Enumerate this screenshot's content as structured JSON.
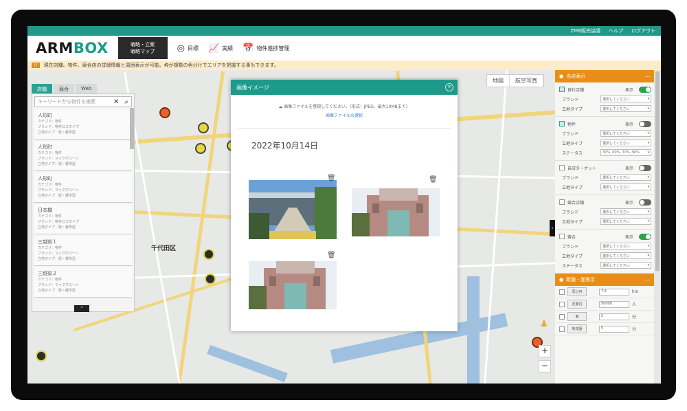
{
  "topbar": {
    "items": [
      "ZMB販売協議",
      "ヘルプ",
      "ログアウト"
    ]
  },
  "header": {
    "logo_main": "ARM",
    "logo_x": "BOX",
    "active_tab_line1": "戦略・立案",
    "active_tab_line2": "戦略マップ",
    "nav": [
      {
        "icon": "◎",
        "label": "目標"
      },
      {
        "icon": "📈",
        "label": "実績"
      },
      {
        "icon": "📅",
        "label": "物件進捗管理"
      }
    ]
  },
  "notice": {
    "badge": "!!",
    "text": "現在店舗、物件、競合店の詳細情報と周囲表示が可能。枠が複数の色分けでエリアを把握する事もできます。"
  },
  "map": {
    "type_left": [
      "地図",
      "航空写真"
    ],
    "area_label": "千代田区",
    "left_tabs": [
      "店舗",
      "競合",
      "Web"
    ],
    "search_placeholder": "キーワードから物件を検索",
    "list": [
      {
        "title": "人形町",
        "sub": [
          "カテゴリ：物件",
          "ブランド：物件ロゴタイプ",
          "立地タイプ：駅・都市型"
        ]
      },
      {
        "title": "人形町",
        "sub": [
          "カテゴリ：物件",
          "ブランド：マックグローン",
          "立地タイプ：駅・都市型"
        ]
      },
      {
        "title": "人形町",
        "sub": [
          "カテゴリ：物件",
          "ブランド：マックグローン",
          "立地タイプ：駅・都市型"
        ]
      },
      {
        "title": "日本橋",
        "sub": [
          "カテゴリ：物件",
          "ブランド：物件ロゴタイプ",
          "立地タイプ：駅・都市型"
        ]
      },
      {
        "title": "三越前１",
        "sub": [
          "カテゴリ：物件",
          "ブランド：マックグローン",
          "立地タイプ：駅・都市型"
        ]
      },
      {
        "title": "三越前２",
        "sub": [
          "カテゴリ：物件",
          "ブランド：マックグローン",
          "立地タイプ：駅・都市型"
        ]
      }
    ]
  },
  "dialog": {
    "title": "画像イメージ",
    "upload_text": "画像ファイルを登録してください。（形式：JPEG、最大10MBまで）",
    "upload_link": "画像ファイルの選択",
    "date": "2022年10月14日"
  },
  "right_panel": {
    "header1": "当店表示",
    "sections": [
      {
        "label": "自社店舗",
        "toggle_label": "表示",
        "on": true,
        "checked": true,
        "rows": [
          {
            "label": "ブランド",
            "value": "選択してください"
          },
          {
            "label": "立地タイプ",
            "value": "選択してください"
          }
        ]
      },
      {
        "label": "物件",
        "toggle_label": "表示",
        "on": false,
        "checked": true,
        "rows": [
          {
            "label": "ブランド",
            "value": "選択してください"
          },
          {
            "label": "立地タイプ",
            "value": "選択してください"
          },
          {
            "label": "ステータス",
            "value": "30%, 60%, 70%, 90%"
          }
        ]
      },
      {
        "label": "自店ターゲット",
        "toggle_label": "表示",
        "on": false,
        "checked": false,
        "rows": [
          {
            "label": "ブランド",
            "value": "選択してください"
          },
          {
            "label": "立地タイプ",
            "value": "選択してください"
          }
        ]
      },
      {
        "label": "競合店舗",
        "toggle_label": "表示",
        "on": false,
        "checked": false,
        "rows": [
          {
            "label": "ブランド",
            "value": "選択してください"
          },
          {
            "label": "立地タイプ",
            "value": "選択してください"
          }
        ]
      },
      {
        "label": "競合",
        "toggle_label": "表示",
        "on": true,
        "checked": false,
        "rows": [
          {
            "label": "ブランド",
            "value": "選択してください"
          },
          {
            "label": "立地タイプ",
            "value": "選択してください"
          },
          {
            "label": "ステータス",
            "value": "選択してください"
          }
        ]
      }
    ],
    "header2": "距離・面表示",
    "distance": [
      {
        "tag": "同心円",
        "value": "7.5",
        "unit": "km"
      },
      {
        "tag": "定量円",
        "value": "50000",
        "unit": "人"
      },
      {
        "tag": "面",
        "value": "5",
        "unit": "分"
      },
      {
        "tag": "到達圏",
        "value": "5",
        "unit": "分"
      }
    ]
  }
}
